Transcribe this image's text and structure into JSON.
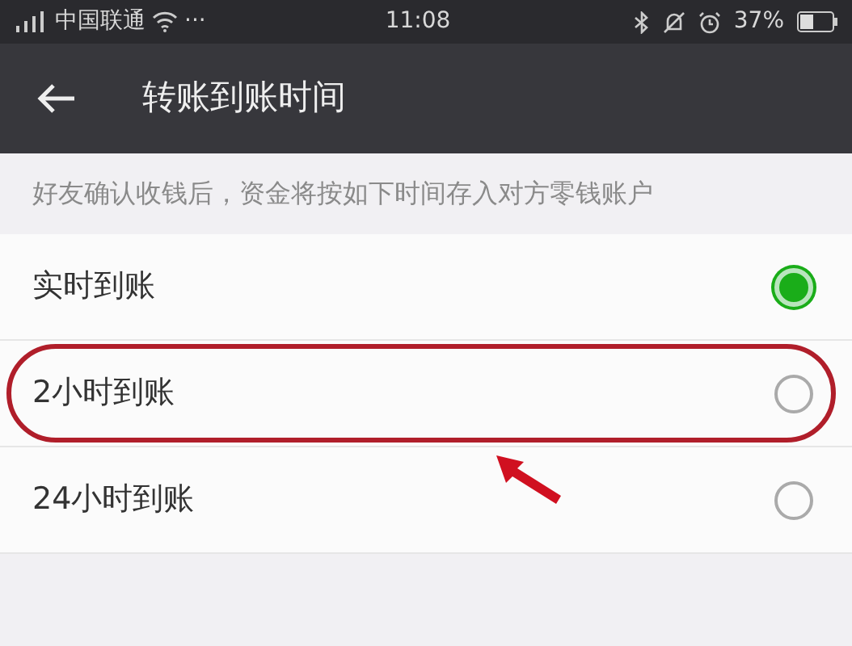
{
  "status_bar": {
    "carrier": "中国联通",
    "dots": "···",
    "time": "11:08",
    "battery": "37%"
  },
  "header": {
    "title": "转账到账时间"
  },
  "description": "好友确认收钱后，资金将按如下时间存入对方零钱账户",
  "options": [
    {
      "label": "实时到账",
      "selected": true
    },
    {
      "label": "2小时到账",
      "selected": false,
      "highlighted": true
    },
    {
      "label": "24小时到账",
      "selected": false
    }
  ]
}
